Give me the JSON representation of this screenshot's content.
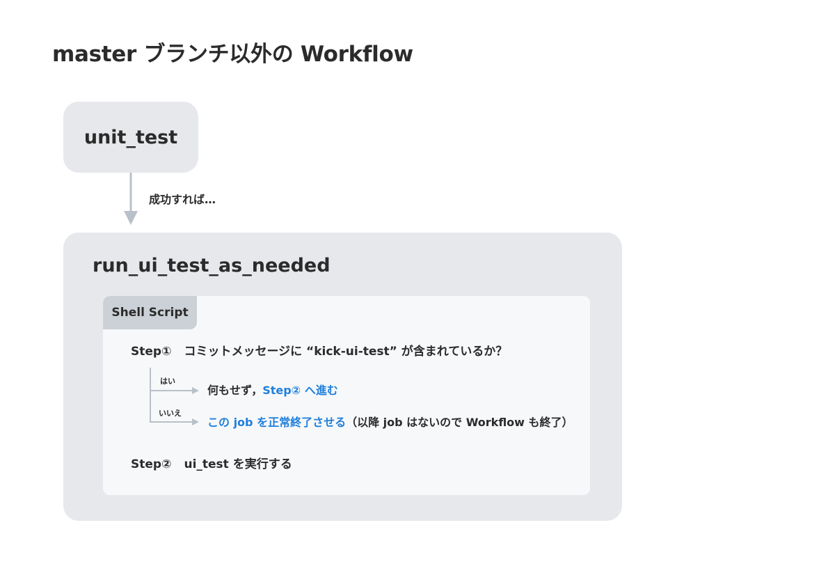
{
  "title": "master ブランチ以外の Workflow",
  "colors": {
    "box_fill": "#e6e8ec",
    "card_fill": "#f7f8fa",
    "tab_fill": "#ccd1d8",
    "arrow": "#b9c0c9",
    "accent": "#1f7fdc",
    "text": "#2b2b2b"
  },
  "first_job": {
    "name": "unit_test"
  },
  "connector": {
    "label": "成功すれば…"
  },
  "second_job": {
    "name": "run_ui_test_as_needed",
    "script": {
      "tab_label": "Shell Script",
      "step1": {
        "number": "Step①",
        "question": "コミットメッセージに “kick-ui-test” が含まれているか？"
      },
      "yes_branch": {
        "label": "はい",
        "text_plain": "何もせず，",
        "text_accent": "Step② へ進む"
      },
      "no_branch": {
        "label": "いいえ",
        "text_accent": "この job を正常終了させる",
        "text_plain": "（以降 job はないので Workflow も終了）"
      },
      "step2": {
        "number": "Step②",
        "text": "ui_test を実行する"
      }
    }
  }
}
